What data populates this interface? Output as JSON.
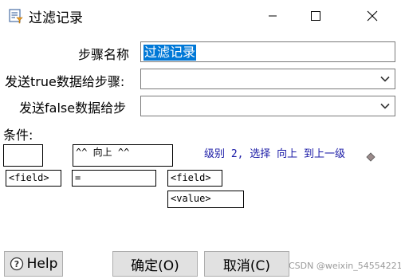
{
  "window": {
    "title": "过滤记录",
    "minimize_icon": "minimize-icon",
    "maximize_icon": "maximize-icon",
    "close_icon": "close-icon"
  },
  "form": {
    "step_name_label": "步骤名称",
    "step_name_value": "过滤记录",
    "true_step_label": "发送true数据给步骤:",
    "true_step_value": "",
    "false_step_label": "发送false数据给步",
    "false_step_value": ""
  },
  "conditions": {
    "label": "条件:",
    "up_button": "^^ 向上 ^^",
    "level_info": "级别 2, 选择 向上 到上一级",
    "left_field": "<field>",
    "operator": "=",
    "right_field": "<field>",
    "right_value": "<value>"
  },
  "buttons": {
    "help": "Help",
    "ok": "确定(O)",
    "cancel": "取消(C)"
  },
  "watermark": "CSDN @weixin_54554221",
  "colors": {
    "selection": "#0078d7",
    "info_text": "#1a1aa6",
    "button_bg": "#e1e1e1"
  }
}
